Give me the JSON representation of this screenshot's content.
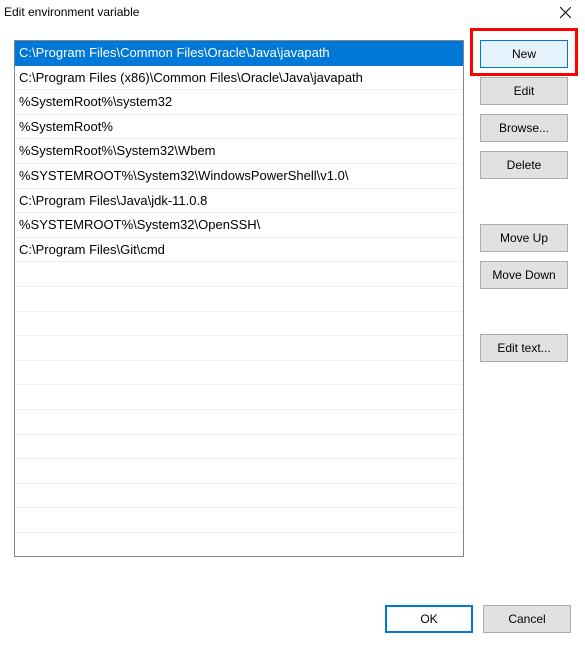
{
  "window": {
    "title": "Edit environment variable"
  },
  "paths": [
    "C:\\Program Files\\Common Files\\Oracle\\Java\\javapath",
    "C:\\Program Files (x86)\\Common Files\\Oracle\\Java\\javapath",
    "%SystemRoot%\\system32",
    "%SystemRoot%",
    "%SystemRoot%\\System32\\Wbem",
    "%SYSTEMROOT%\\System32\\WindowsPowerShell\\v1.0\\",
    "C:\\Program Files\\Java\\jdk-11.0.8",
    "%SYSTEMROOT%\\System32\\OpenSSH\\",
    "C:\\Program Files\\Git\\cmd"
  ],
  "selected_index": 0,
  "buttons": {
    "new": "New",
    "edit": "Edit",
    "browse": "Browse...",
    "delete": "Delete",
    "move_up": "Move Up",
    "move_down": "Move Down",
    "edit_text": "Edit text...",
    "ok": "OK",
    "cancel": "Cancel"
  }
}
